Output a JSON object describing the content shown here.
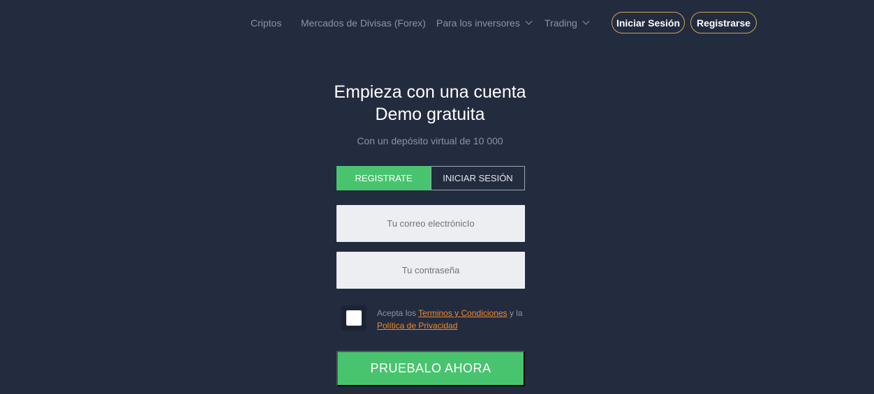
{
  "nav": {
    "links": [
      {
        "label": "Criptos",
        "dropdown": false
      },
      {
        "label": "Mercados de Divisas (Forex)",
        "dropdown": false
      },
      {
        "label": "Para los inversores",
        "dropdown": true
      },
      {
        "label": "Trading",
        "dropdown": true
      }
    ],
    "login_label": "Iniciar Sesión",
    "register_label": "Registrarse"
  },
  "hero": {
    "title_line1": "Empieza con una cuenta",
    "title_line2": "Demo gratuita",
    "subtitle": "Con un depósito virtual de 10 000"
  },
  "tabs": {
    "register": "REGISTRATE",
    "login": "INICIAR SESIÓN",
    "active": "register"
  },
  "form": {
    "email_placeholder": "Tu correo electrónicIo",
    "password_placeholder": "Tu contraseña",
    "checkbox_checked": false,
    "terms_prefix": "Acepta los ",
    "terms_link": "Terminos y Condiciones",
    "terms_middle": " y la ",
    "privacy_link": "Política de Privacidad",
    "cta_label": "PRUEBALO AHORA"
  },
  "colors": {
    "background": "#232b3f",
    "accent_green": "#49c46e",
    "pill_border": "#c9a659",
    "link_orange": "#f28a2b",
    "muted_text": "#8b93a6"
  }
}
